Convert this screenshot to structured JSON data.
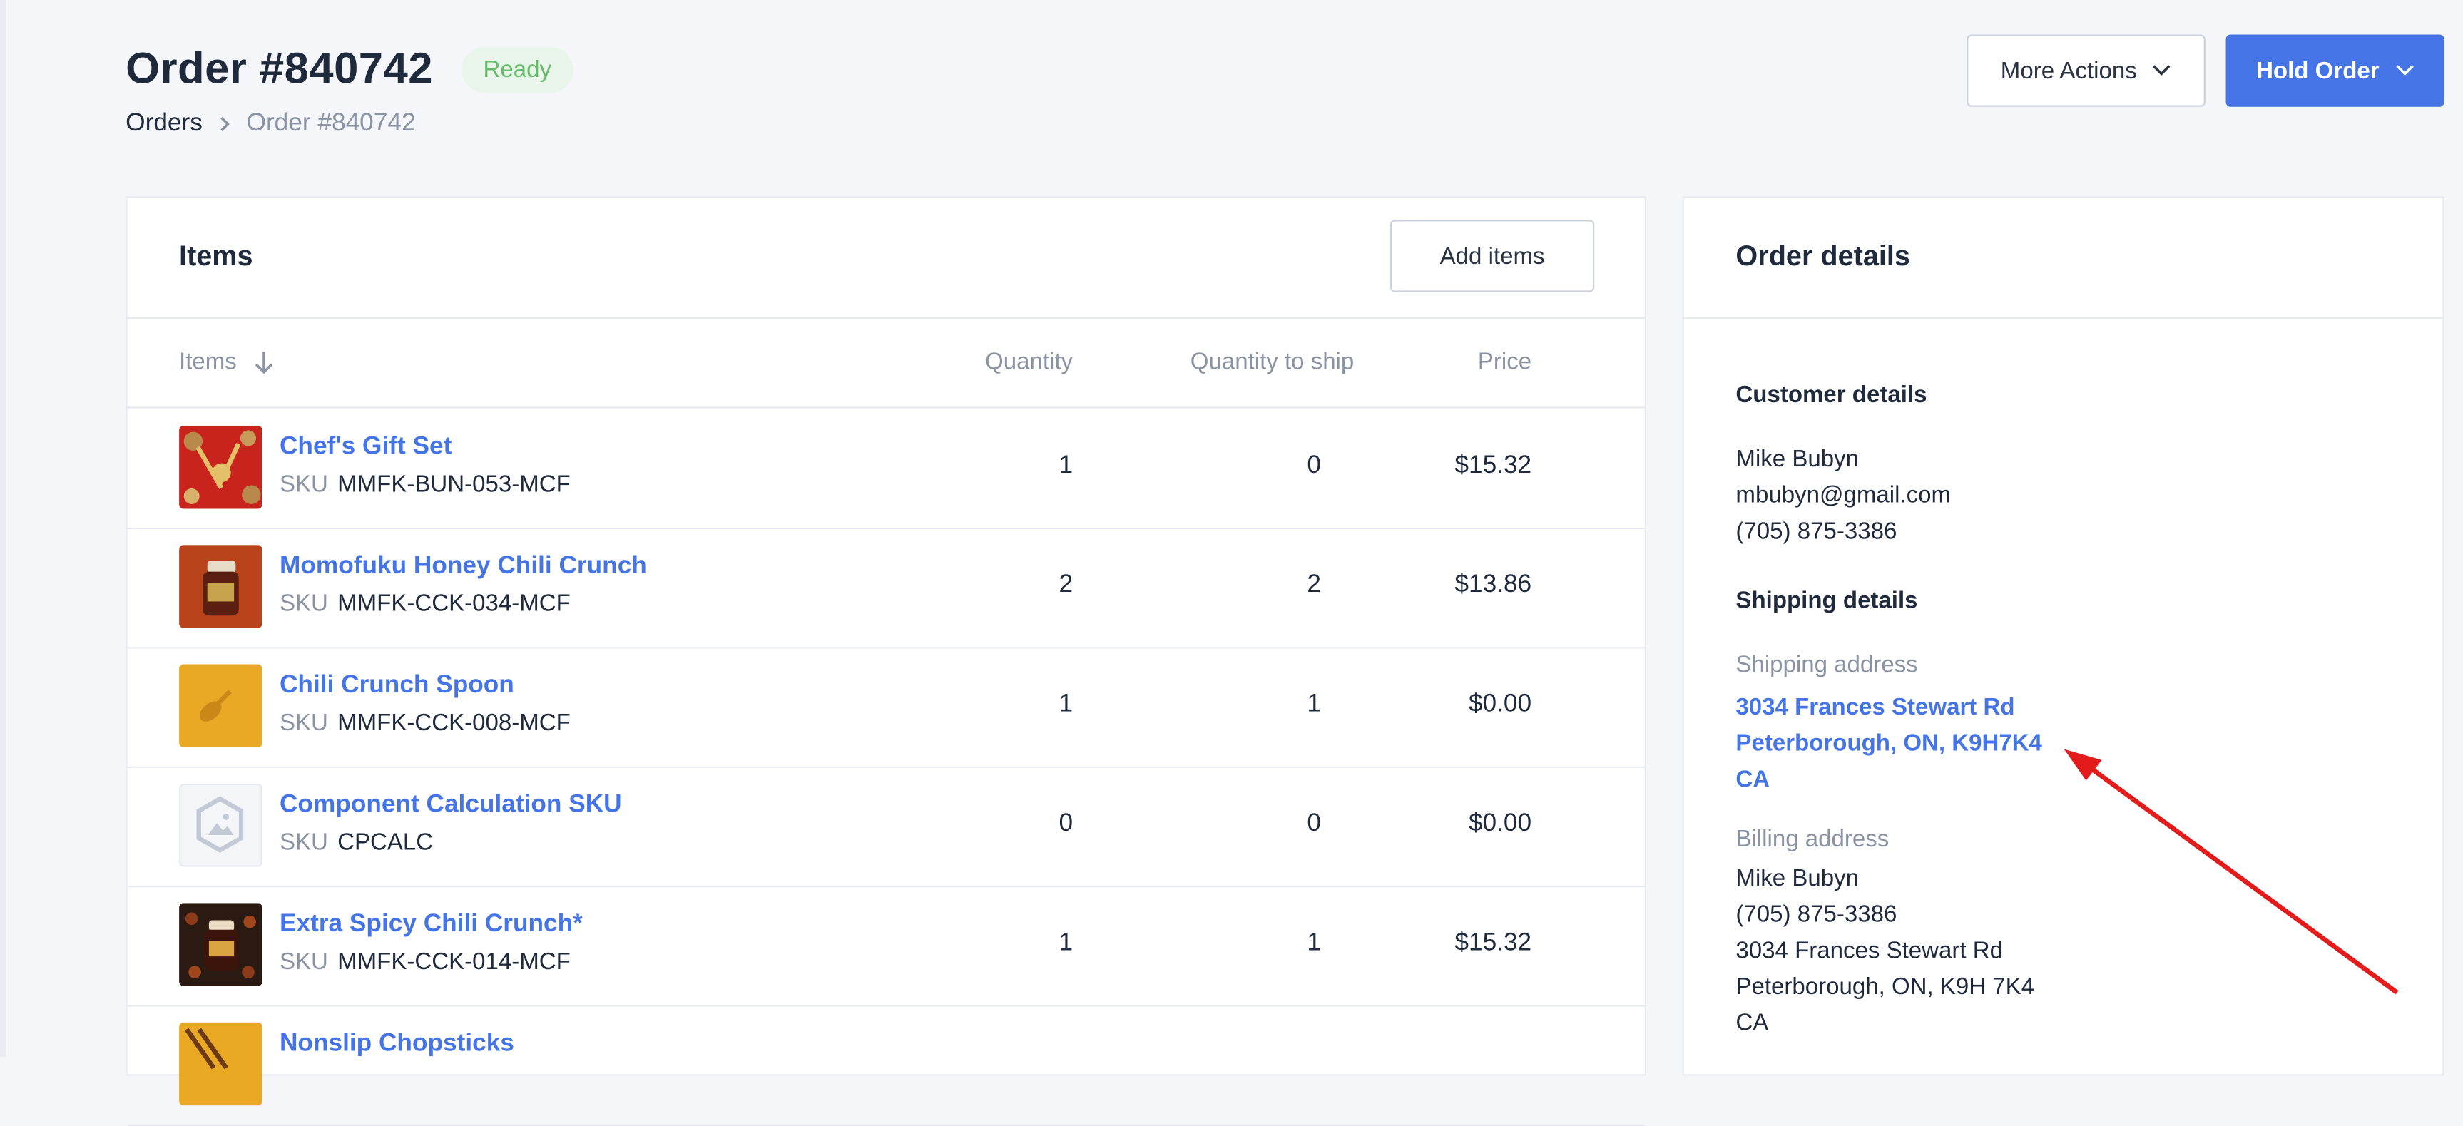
{
  "header": {
    "order_title": "Order #840742",
    "status_badge": "Ready",
    "breadcrumb": {
      "parent": "Orders",
      "current": "Order #840742"
    },
    "more_actions_label": "More Actions",
    "hold_order_label": "Hold Order"
  },
  "items_card": {
    "title": "Items",
    "add_items_label": "Add items",
    "columns": {
      "items": "Items",
      "quantity": "Quantity",
      "quantity_to_ship": "Quantity to ship",
      "price": "Price"
    },
    "sku_label": "SKU",
    "rows": [
      {
        "name": "Chef's Gift Set",
        "sku": "MMFK-BUN-053-MCF",
        "quantity": "1",
        "quantity_to_ship": "0",
        "price": "$15.32",
        "thumb": "gift-set"
      },
      {
        "name": "Momofuku Honey Chili Crunch",
        "sku": "MMFK-CCK-034-MCF",
        "quantity": "2",
        "quantity_to_ship": "2",
        "price": "$13.86",
        "thumb": "honey-jar"
      },
      {
        "name": "Chili Crunch Spoon",
        "sku": "MMFK-CCK-008-MCF",
        "quantity": "1",
        "quantity_to_ship": "1",
        "price": "$0.00",
        "thumb": "spoon"
      },
      {
        "name": "Component Calculation SKU",
        "sku": "CPCALC",
        "quantity": "0",
        "quantity_to_ship": "0",
        "price": "$0.00",
        "thumb": "placeholder-image-icon"
      },
      {
        "name": "Extra Spicy Chili Crunch*",
        "sku": "MMFK-CCK-014-MCF",
        "quantity": "1",
        "quantity_to_ship": "1",
        "price": "$15.32",
        "thumb": "spicy-jar"
      },
      {
        "name": "Nonslip Chopsticks",
        "thumb": "chopsticks"
      }
    ]
  },
  "order_details": {
    "title": "Order details",
    "customer_heading": "Customer details",
    "customer": {
      "name": "Mike Bubyn",
      "email": "mbubyn@gmail.com",
      "phone": "(705) 875-3386"
    },
    "shipping_heading": "Shipping details",
    "shipping_address_label": "Shipping address",
    "shipping_address": {
      "line1": "3034 Frances Stewart Rd",
      "line2": "Peterborough, ON, K9H7K4",
      "line3": "CA"
    },
    "billing_address_label": "Billing address",
    "billing_address": {
      "name": "Mike Bubyn",
      "phone": "(705) 875-3386",
      "line1": "3034 Frances Stewart Rd",
      "line2": "Peterborough, ON, K9H 7K4",
      "line3": "CA"
    }
  },
  "colors": {
    "accent": "#4574e6",
    "badge_bg": "#e9f4ea",
    "badge_text": "#66bb6a",
    "annotation_arrow": "#e31b1b"
  }
}
